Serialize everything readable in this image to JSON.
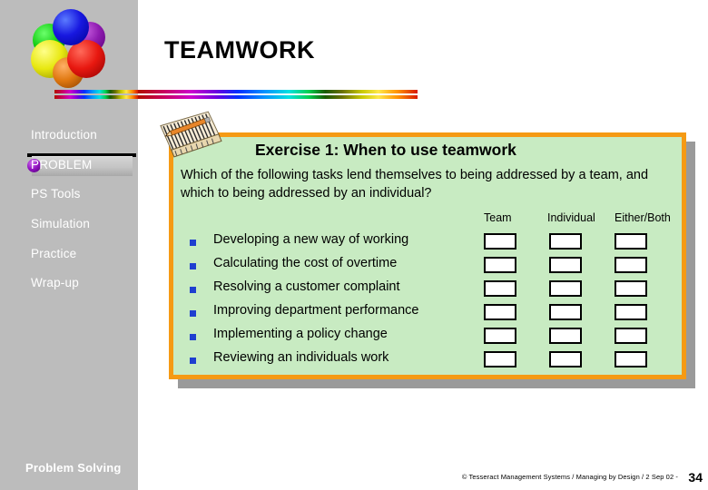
{
  "slide": {
    "title": "TEAMWORK",
    "background_color": "#ffffff",
    "sidebar_color": "#bcbcbc"
  },
  "sidebar": {
    "logo": {
      "name": "colored-spheres-logo",
      "spheres": [
        "blue",
        "purple",
        "green",
        "red",
        "yellow",
        "orange"
      ]
    },
    "items": [
      {
        "label": "Introduction",
        "active": false
      },
      {
        "label": "PROBLEM",
        "active": true
      },
      {
        "label": "PS Tools",
        "active": false
      },
      {
        "label": "Simulation",
        "active": false
      },
      {
        "label": "Practice",
        "active": false
      },
      {
        "label": "Wrap-up",
        "active": false
      }
    ],
    "footer_label": "Problem Solving",
    "accent_bullet_color": "#9010c0"
  },
  "exercise": {
    "icon": "notepad-pencil-icon",
    "heading": "Exercise 1: When to use teamwork",
    "question": "Which of the following tasks lend themselves to being addressed by a team, and which to being addressed by an individual?",
    "border_color": "#f59a14",
    "panel_color": "#c8ebc2",
    "columns": [
      "Team",
      "Individual",
      "Either/Both"
    ],
    "tasks": [
      {
        "label": "Developing a new way of working",
        "checked": [
          false,
          false,
          false
        ]
      },
      {
        "label": "Calculating the cost of overtime",
        "checked": [
          false,
          false,
          false
        ]
      },
      {
        "label": "Resolving a customer complaint",
        "checked": [
          false,
          false,
          false
        ]
      },
      {
        "label": "Improving department performance",
        "checked": [
          false,
          false,
          false
        ]
      },
      {
        "label": "Implementing a policy change",
        "checked": [
          false,
          false,
          false
        ]
      },
      {
        "label": "Reviewing an individuals work",
        "checked": [
          false,
          false,
          false
        ]
      }
    ]
  },
  "footer": {
    "credit": "© Tesseract Management Systems / Managing by Design / 2 Sep 02  -",
    "page_number": "34"
  }
}
